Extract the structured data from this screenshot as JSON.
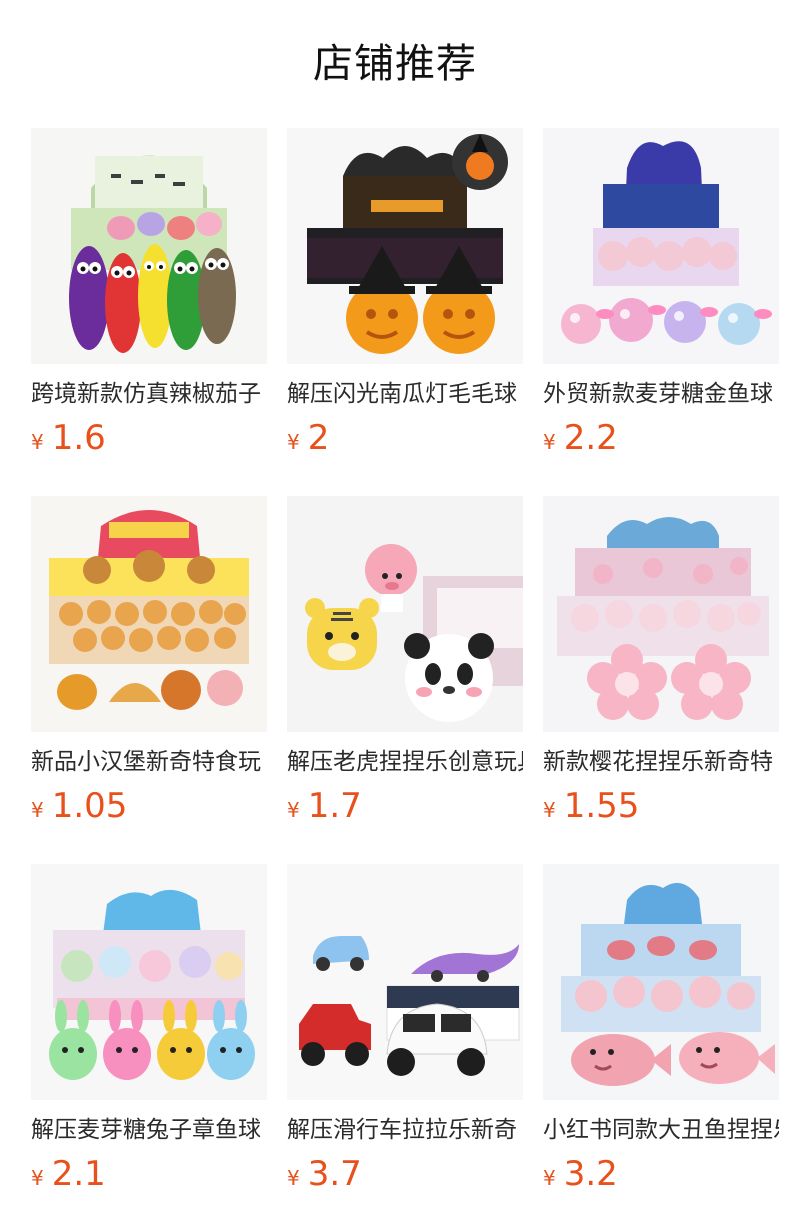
{
  "section": {
    "title": "店铺推荐"
  },
  "products": [
    {
      "name": "跨境新款仿真辣椒茄子",
      "currency": "¥",
      "price": "1.6",
      "icon": "vegetable-squishy-toy-icon"
    },
    {
      "name": "解压闪光南瓜灯毛毛球",
      "currency": "¥",
      "price": "2",
      "icon": "pumpkin-light-toy-icon"
    },
    {
      "name": "外贸新款麦芽糖金鱼球",
      "currency": "¥",
      "price": "2.2",
      "icon": "goldfish-ball-toy-icon"
    },
    {
      "name": "新品小汉堡新奇特食玩",
      "currency": "¥",
      "price": "1.05",
      "icon": "hamburger-squishy-toy-icon"
    },
    {
      "name": "解压老虎捏捏乐创意玩具",
      "currency": "¥",
      "price": "1.7",
      "icon": "tiger-squishy-toy-icon"
    },
    {
      "name": "新款樱花捏捏乐新奇特",
      "currency": "¥",
      "price": "1.55",
      "icon": "sakura-squishy-toy-icon"
    },
    {
      "name": "解压麦芽糖兔子章鱼球",
      "currency": "¥",
      "price": "2.1",
      "icon": "bunny-octopus-toy-icon"
    },
    {
      "name": "解压滑行车拉拉乐新奇",
      "currency": "¥",
      "price": "3.7",
      "icon": "pullback-car-toy-icon"
    },
    {
      "name": "小红书同款大丑鱼捏捏乐",
      "currency": "¥",
      "price": "3.2",
      "icon": "blobfish-squishy-toy-icon"
    }
  ]
}
